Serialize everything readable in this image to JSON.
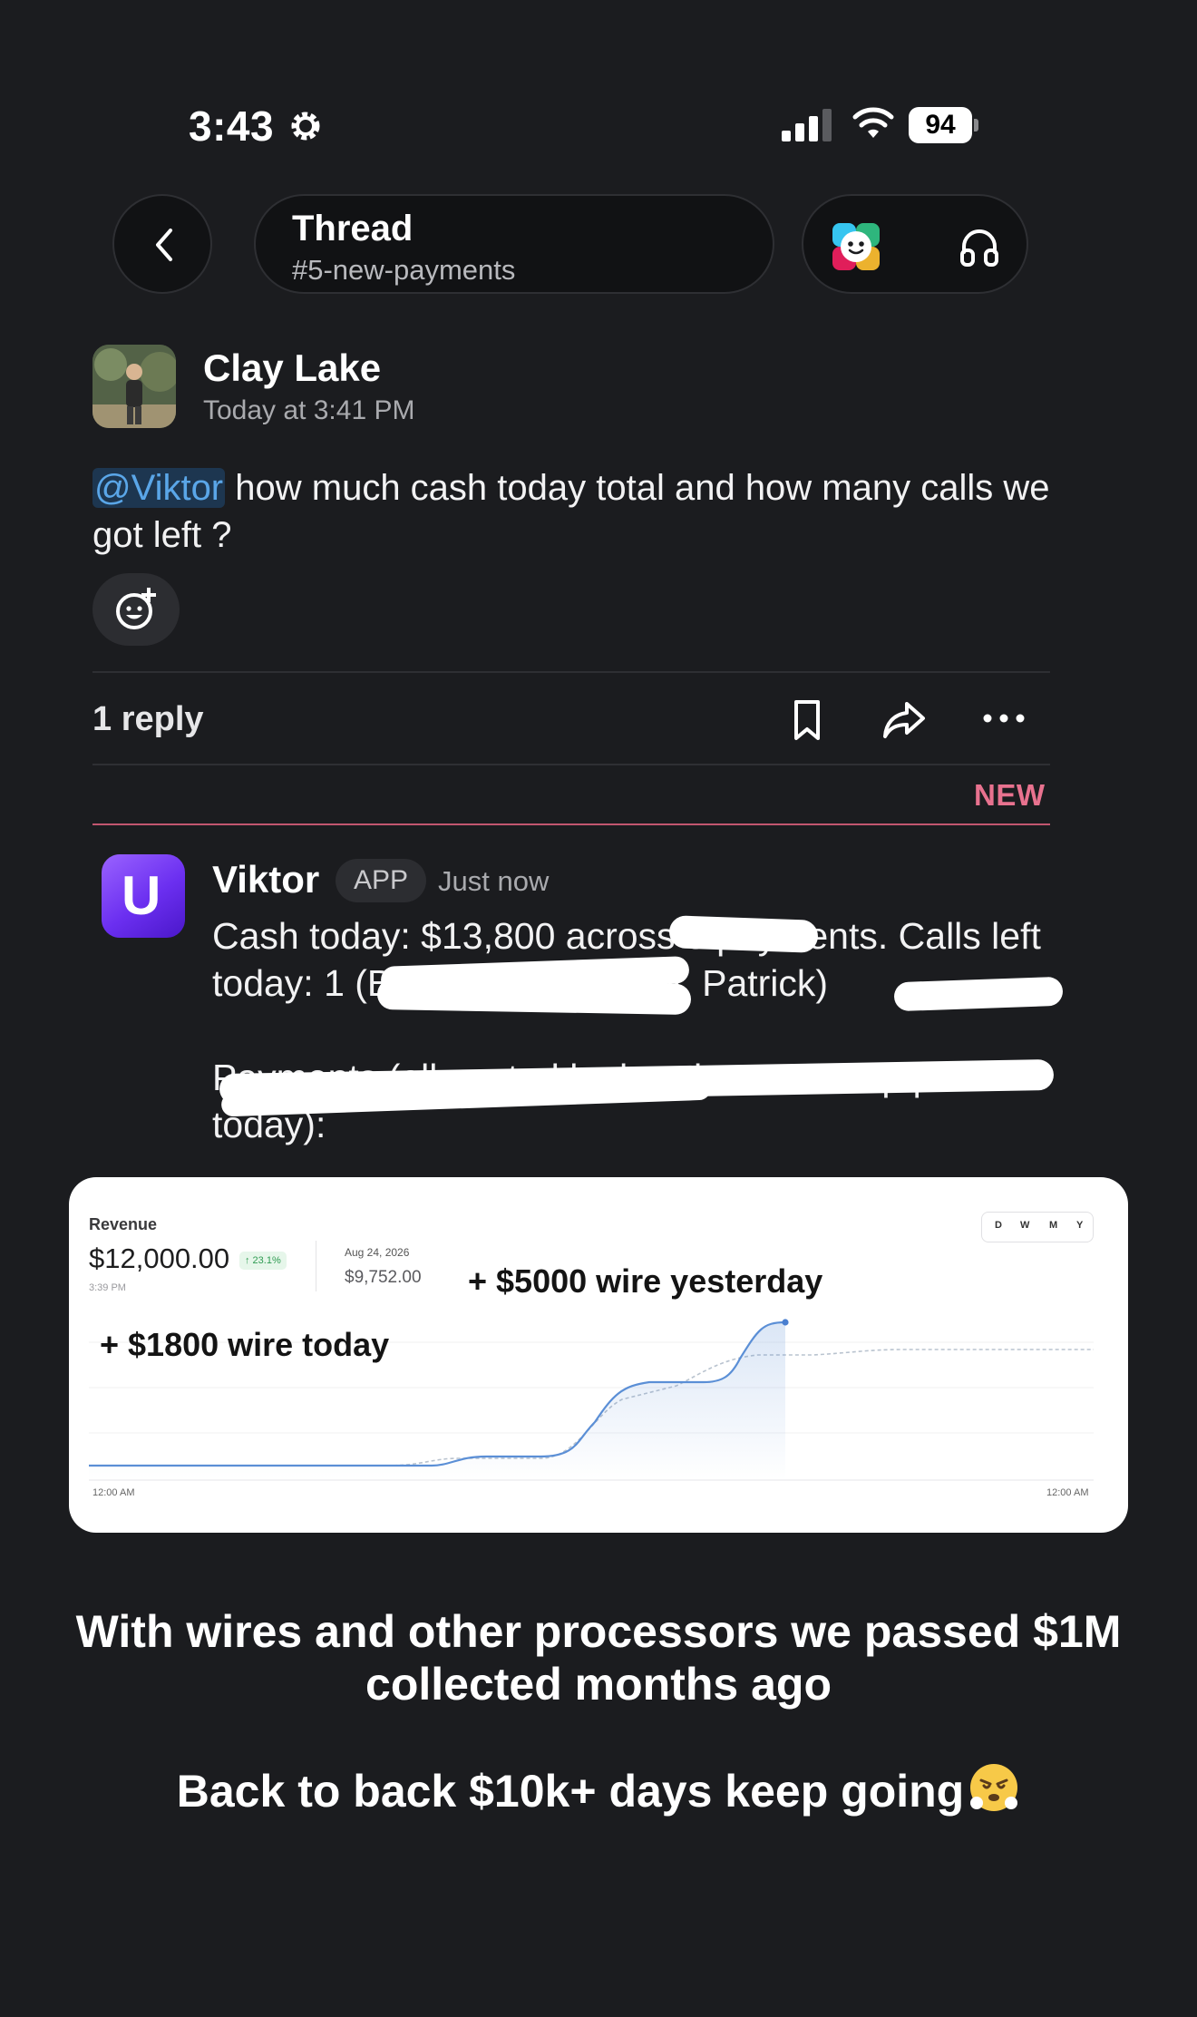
{
  "status_bar": {
    "time": "3:43",
    "battery": "94"
  },
  "header": {
    "title": "Thread",
    "channel": "#5-new-payments"
  },
  "message1": {
    "author": "Clay Lake",
    "timestamp": "Today at 3:41 PM",
    "mention": "@Viktor",
    "text": " how much cash today total and how many calls we got left ?"
  },
  "thread": {
    "reply_count": "1 reply",
    "new_label": "NEW"
  },
  "message2": {
    "author": "Viktor",
    "badge": "APP",
    "timestamp": "Just now",
    "line1": "Cash today: $13,800 across 5 payments. Calls left today: 1 (Benjamin, 5:00 PM, Patrick)",
    "line2": "Payments (all posted by hand — zero zap posts today):"
  },
  "revenue_card": {
    "label": "Revenue",
    "value": "$12,000.00",
    "change": "↑ 23.1%",
    "time": "3:39 PM",
    "compare_date": "Aug 24, 2026",
    "compare_value": "$9,752.00",
    "range_tabs": [
      "D",
      "W",
      "M",
      "Y"
    ],
    "annotation_yesterday": "+ $5000 wire yesterday",
    "annotation_today": "+ $1800 wire today",
    "axis_start": "12:00 AM",
    "axis_end": "12:00 AM",
    "colors": {
      "today_line": "#5b8fd6",
      "compare_line": "#b9c3cf"
    }
  },
  "caption": {
    "line1": "With wires and other processors we passed $1M collected months ago",
    "line2": "Back to back $10k+ days keep going"
  }
}
